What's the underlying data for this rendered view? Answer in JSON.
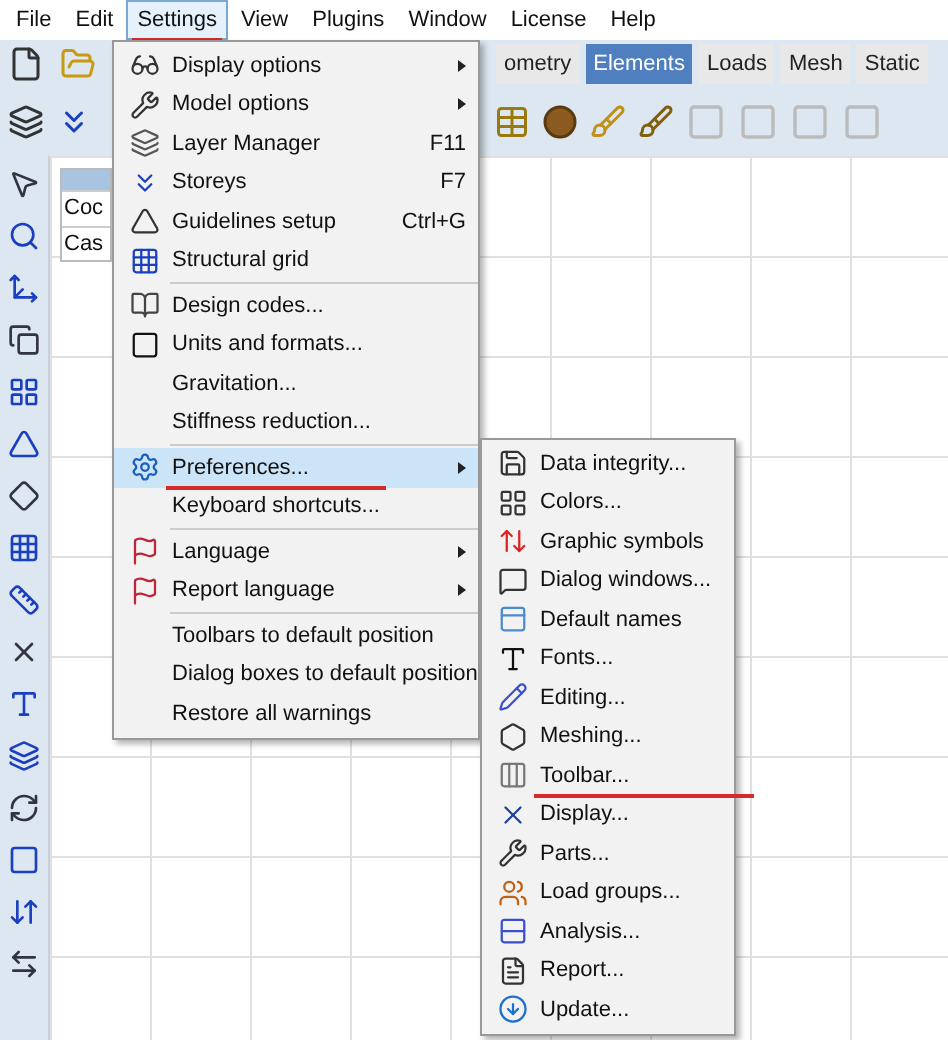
{
  "menu_bar": [
    {
      "label": "File",
      "selected": false
    },
    {
      "label": "Edit",
      "selected": false
    },
    {
      "label": "Settings",
      "selected": true,
      "underlined": true
    },
    {
      "label": "View",
      "selected": false
    },
    {
      "label": "Plugins",
      "selected": false
    },
    {
      "label": "Window",
      "selected": false
    },
    {
      "label": "License",
      "selected": false
    },
    {
      "label": "Help",
      "selected": false
    }
  ],
  "tabs": [
    {
      "label": "ometry",
      "selected": false
    },
    {
      "label": "Elements",
      "selected": true
    },
    {
      "label": "Loads",
      "selected": false
    },
    {
      "label": "Mesh",
      "selected": false
    },
    {
      "label": "Static",
      "selected": false
    }
  ],
  "side_panel": {
    "rows": [
      "Coc",
      "Cas"
    ]
  },
  "settings_menu": {
    "groups": [
      [
        {
          "label": "Display options",
          "submenu": true
        },
        {
          "label": "Model options",
          "submenu": true
        },
        {
          "label": "Layer Manager",
          "shortcut": "F11"
        },
        {
          "label": "Storeys",
          "shortcut": "F7"
        },
        {
          "label": "Guidelines setup",
          "shortcut": "Ctrl+G"
        },
        {
          "label": "Structural grid"
        }
      ],
      [
        {
          "label": "Design codes..."
        },
        {
          "label": "Units and formats..."
        },
        {
          "label": "Gravitation..."
        },
        {
          "label": "Stiffness reduction..."
        }
      ],
      [
        {
          "label": "Preferences...",
          "submenu": true,
          "highlighted": true,
          "underlined": true
        },
        {
          "label": "Keyboard shortcuts..."
        }
      ],
      [
        {
          "label": "Language",
          "submenu": true
        },
        {
          "label": "Report language",
          "submenu": true
        }
      ],
      [
        {
          "label": "Toolbars to default position"
        },
        {
          "label": "Dialog boxes to default position"
        },
        {
          "label": "Restore all warnings"
        }
      ]
    ]
  },
  "preferences_menu": {
    "items": [
      {
        "label": "Data integrity..."
      },
      {
        "label": "Colors..."
      },
      {
        "label": "Graphic symbols"
      },
      {
        "label": "Dialog windows..."
      },
      {
        "label": "Default names"
      },
      {
        "label": "Fonts..."
      },
      {
        "label": "Editing..."
      },
      {
        "label": "Meshing..."
      },
      {
        "label": "Toolbar...",
        "underlined": true
      },
      {
        "label": "Display..."
      },
      {
        "label": "Parts..."
      },
      {
        "label": "Load groups..."
      },
      {
        "label": "Analysis..."
      },
      {
        "label": "Report..."
      },
      {
        "label": "Update..."
      }
    ]
  }
}
